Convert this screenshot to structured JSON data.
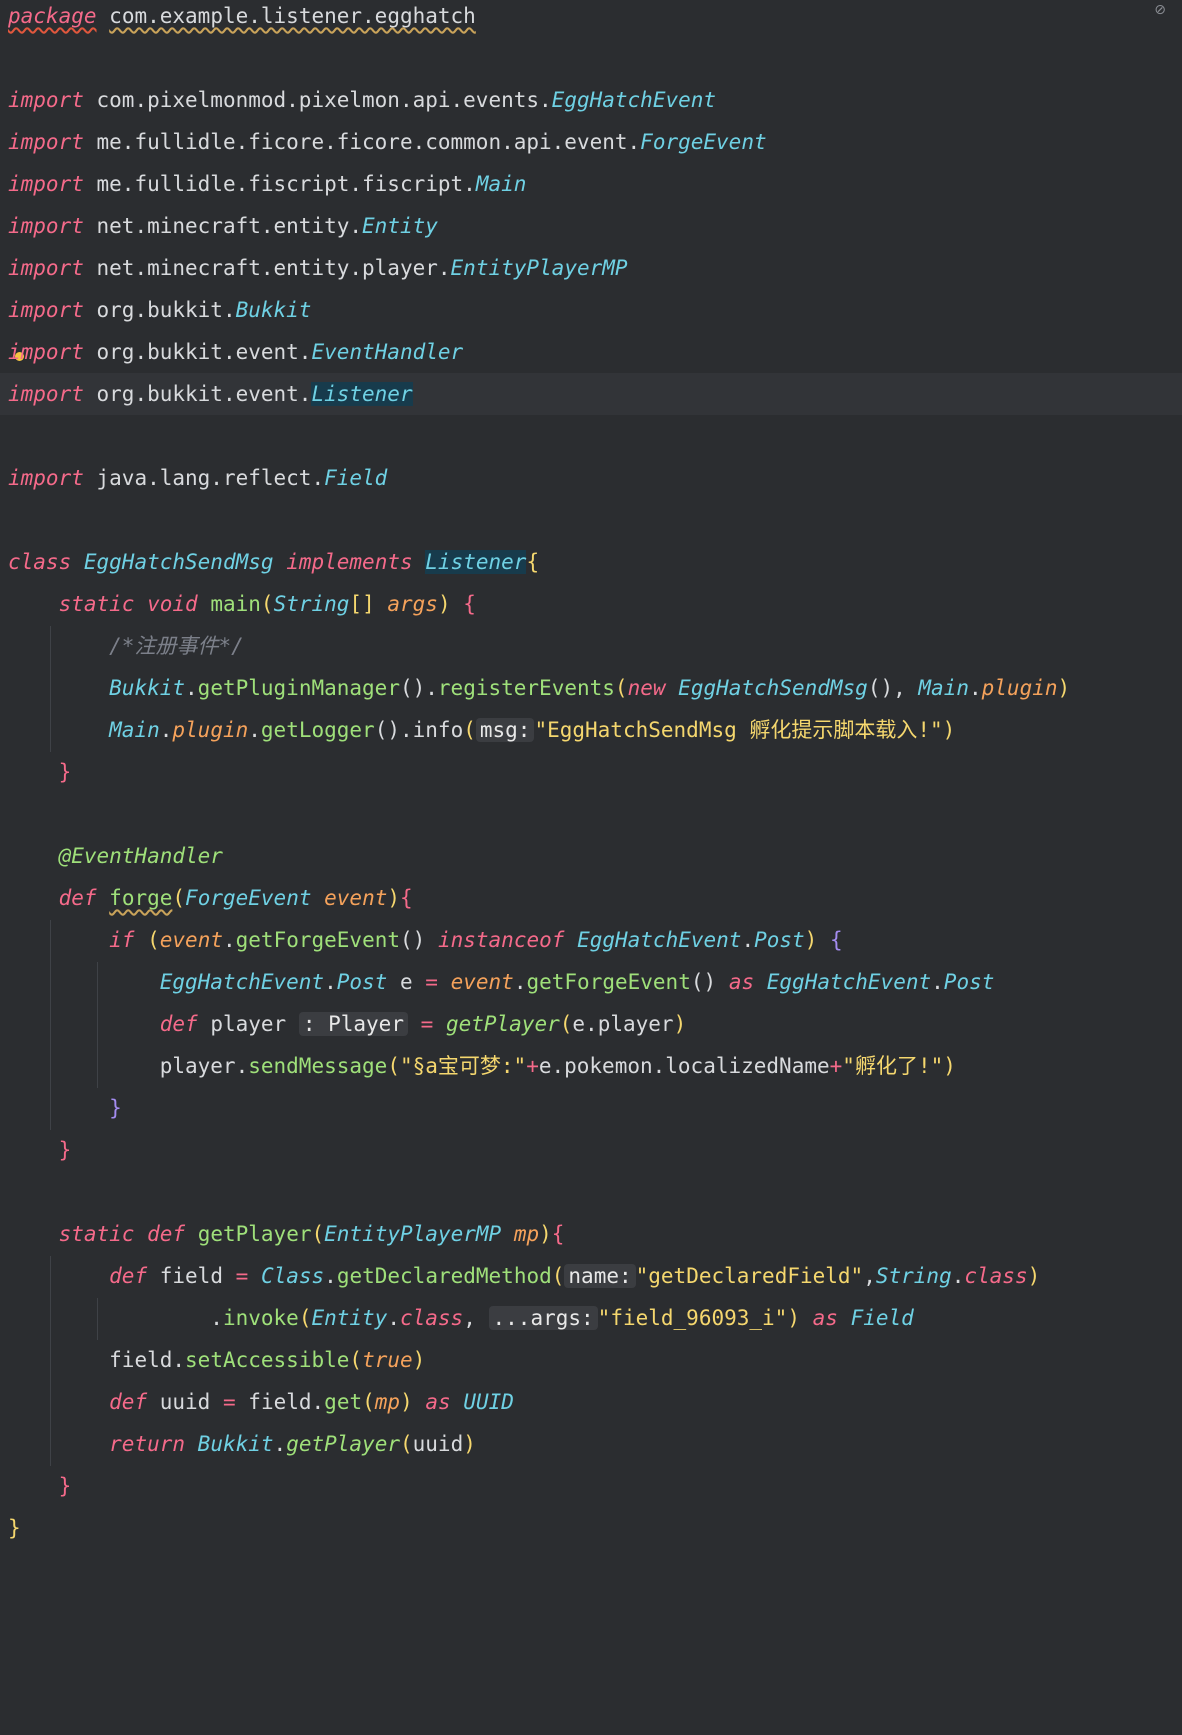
{
  "editor": {
    "toolbar_icon": "eye-crossed-icon",
    "lines": {
      "l1": {
        "kw": "package",
        "path": "com.example.listener.egghatch"
      },
      "l3": {
        "kw": "import",
        "pkg": "com.pixelmonmod.pixelmon.api.events.",
        "cls": "EggHatchEvent"
      },
      "l4": {
        "kw": "import",
        "pkg": "me.fullidle.ficore.ficore.common.api.event.",
        "cls": "ForgeEvent"
      },
      "l5": {
        "kw": "import",
        "pkg": "me.fullidle.fiscript.fiscript.",
        "cls": "Main"
      },
      "l6": {
        "kw": "import",
        "pkg": "net.minecraft.entity.",
        "cls": "Entity"
      },
      "l7": {
        "kw": "import",
        "pkg": "net.minecraft.entity.player.",
        "cls": "EntityPlayerMP"
      },
      "l8": {
        "kw": "import",
        "pkg": "org.bukkit.",
        "cls": "Bukkit"
      },
      "l9": {
        "kw": "import",
        "pkg": "org.bukkit.event.",
        "cls": "EventHandler"
      },
      "l10": {
        "kw": "import",
        "pkg": "org.bukkit.event.",
        "cls": "Listener"
      },
      "l12": {
        "kw": "import",
        "pkg": "java.lang.reflect.",
        "cls": "Field"
      },
      "l14": {
        "kw": "class",
        "name": "EggHatchSendMsg",
        "kw2": "implements",
        "iface": "Listener",
        "brace": "{"
      },
      "l15": {
        "k1": "static",
        "k2": "void",
        "fn": "main",
        "p1": "(",
        "type": "String",
        "arr": "[]",
        "arg": "args",
        "p2": ")",
        "brace": "{"
      },
      "l16": {
        "comment": "/*注册事件*/"
      },
      "l17": {
        "c1": "Bukkit",
        "dot1": ".",
        "m1": "getPluginManager",
        "p1": "().",
        "m2": "registerEvents",
        "p2": "(",
        "kw": "new",
        "c2": "EggHatchSendMsg",
        "p3": "(), ",
        "c3": "Main",
        "dot2": ".",
        "f": "plugin",
        "p4": ")"
      },
      "l18": {
        "c1": "Main",
        "dot1": ".",
        "f": "plugin",
        "dot2": ".",
        "m1": "getLogger",
        "p1": "().",
        "m2": "info",
        "p2": "(",
        "hint": "msg:",
        "str": "\"EggHatchSendMsg 孵化提示脚本载入!\"",
        "p3": ")"
      },
      "l19": {
        "brace": "}"
      },
      "l21": {
        "ann": "@EventHandler"
      },
      "l22": {
        "kw": "def",
        "fn": "forge",
        "p1": "(",
        "type": "ForgeEvent",
        "arg": "event",
        "p2": ")",
        "brace": "{"
      },
      "l23": {
        "kw": "if",
        "p1": "(",
        "v": "event",
        "dot": ".",
        "m": "getForgeEvent",
        "p2": "()",
        "kw2": "instanceof",
        "c1": "EggHatchEvent",
        "dot2": ".",
        "c2": "Post",
        "p3": ")",
        "brace": "{"
      },
      "l24": {
        "c1": "EggHatchEvent",
        "dot": ".",
        "c2": "Post",
        "var": "e",
        "eq": "=",
        "v": "event",
        "dot2": ".",
        "m": "getForgeEvent",
        "p1": "()",
        "kw": "as",
        "c3": "EggHatchEvent",
        "dot3": ".",
        "c4": "Post"
      },
      "l25": {
        "kw": "def",
        "var": "player",
        "hint": ": Player",
        "eq": "=",
        "m": "getPlayer",
        "p1": "(",
        "arg": "e.player",
        "p2": ")"
      },
      "l26": {
        "v": "player",
        "dot": ".",
        "m": "sendMessage",
        "p1": "(",
        "s1": "\"§a宝可梦:\"",
        "plus1": "+",
        "expr": "e.pokemon.localizedName",
        "plus2": "+",
        "s2": "\"孵化了!\"",
        "p2": ")"
      },
      "l27": {
        "brace": "}"
      },
      "l28": {
        "brace": "}"
      },
      "l30": {
        "k1": "static",
        "k2": "def",
        "fn": "getPlayer",
        "p1": "(",
        "type": "EntityPlayerMP",
        "arg": "mp",
        "p2": ")",
        "brace": "{"
      },
      "l31": {
        "kw": "def",
        "var": "field",
        "eq": "=",
        "c1": "Class",
        "dot": ".",
        "m": "getDeclaredMethod",
        "p1": "(",
        "hint": "name:",
        "str": "\"getDeclaredField\"",
        "comma": ",",
        "c2": "String",
        "dot2": ".",
        "k": "class",
        "p2": ")"
      },
      "l32": {
        "dot": ".",
        "m": "invoke",
        "p1": "(",
        "c1": "Entity",
        "dot2": ".",
        "k": "class",
        "comma": ",",
        "hint": "...args:",
        "str": "\"field_96093_i\"",
        "p2": ")",
        "kw": "as",
        "c2": "Field"
      },
      "l33": {
        "v": "field",
        "dot": ".",
        "m": "setAccessible",
        "p1": "(",
        "k": "true",
        "p2": ")"
      },
      "l34": {
        "kw": "def",
        "var": "uuid",
        "eq": "=",
        "v": "field",
        "dot": ".",
        "m": "get",
        "p1": "(",
        "arg": "mp",
        "p2": ")",
        "kw2": "as",
        "c1": "UUID"
      },
      "l35": {
        "kw": "return",
        "c1": "Bukkit",
        "dot": ".",
        "m": "getPlayer",
        "p1": "(",
        "arg": "uuid",
        "p2": ")"
      },
      "l36": {
        "brace": "}"
      },
      "l37": {
        "brace": "}"
      }
    }
  }
}
